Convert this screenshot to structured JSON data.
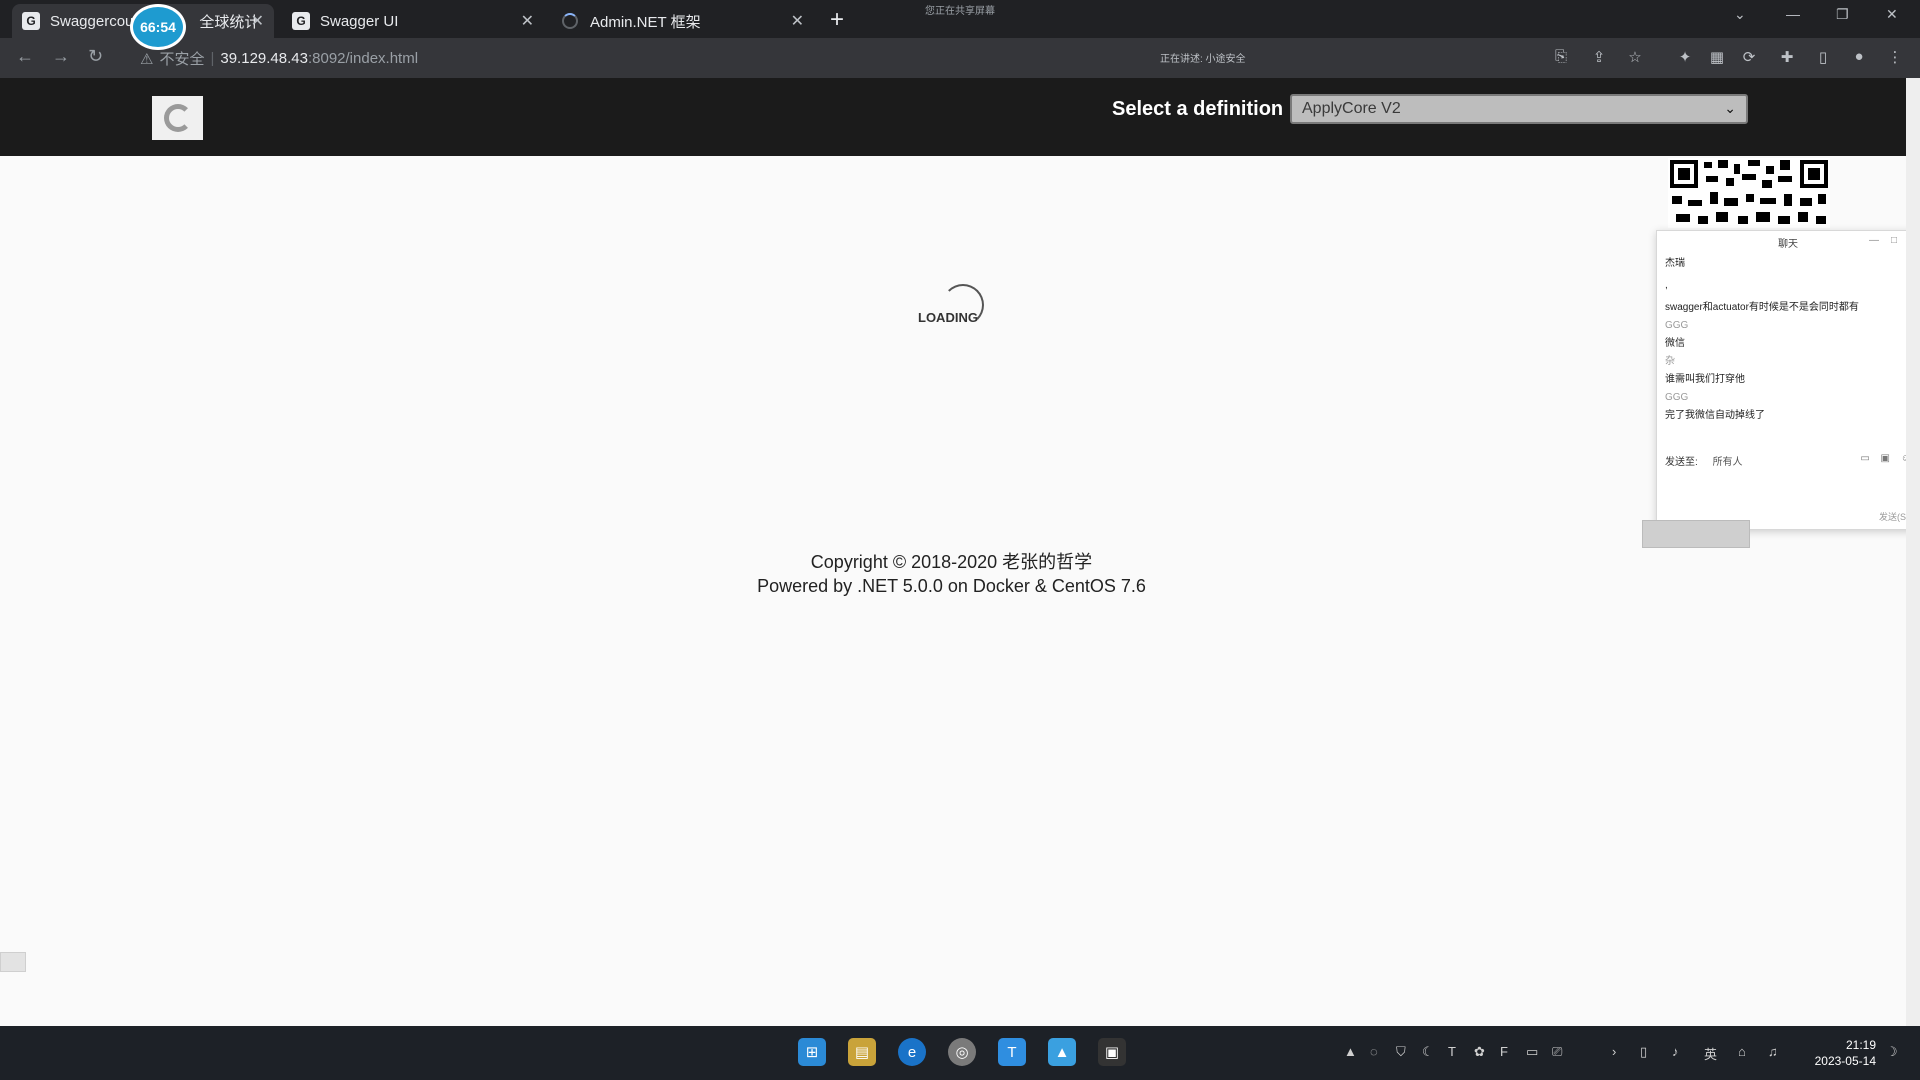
{
  "browser": {
    "tabs": [
      {
        "title": "Swaggercou",
        "suffix": "全球统计",
        "active": true
      },
      {
        "title": "Swagger UI",
        "active": false
      },
      {
        "title": "Admin.NET 框架",
        "active": false,
        "loading": true
      }
    ],
    "timer": "66:54",
    "share_note": "您正在共享屏幕",
    "listen_note": "正在讲述: 小途安全",
    "security_label": "不安全",
    "url_host": "39.129.48.43",
    "url_rest": ":8092/index.html"
  },
  "swagger": {
    "definition_label": "Select a definition",
    "definition_value": "ApplyCore V2",
    "loading_text": "LOADING",
    "footer_line1": "Copyright © 2018-2020 老张的哲学",
    "footer_line2": "Powered by .NET 5.0.0 on Docker & CentOS 7.6"
  },
  "chat": {
    "title": "聊天",
    "messages": [
      {
        "text": "杰瑞",
        "gray": false
      },
      {
        "text": ",",
        "gray": false
      },
      {
        "text": "swagger和actuator有时候是不是会同时都有",
        "gray": false
      },
      {
        "text": "GGG",
        "gray": true
      },
      {
        "text": "微信",
        "gray": false
      },
      {
        "text": "杂",
        "gray": true
      },
      {
        "text": "谁需叫我们打穿他",
        "gray": false
      },
      {
        "text": "GGG",
        "gray": true
      },
      {
        "text": "完了我微信自动掉线了",
        "gray": false
      }
    ],
    "send_to_label": "发送至:",
    "send_to_value": "所有人",
    "send_button": "发送(S)"
  },
  "taskbar": {
    "lang": "英",
    "time": "21:19",
    "date": "2023-05-14"
  },
  "colors": {
    "accent": "#1e9bd0",
    "chrome_dark": "#202124",
    "swagger_bar": "#1b1b1b",
    "taskbar": "#1d2127"
  }
}
